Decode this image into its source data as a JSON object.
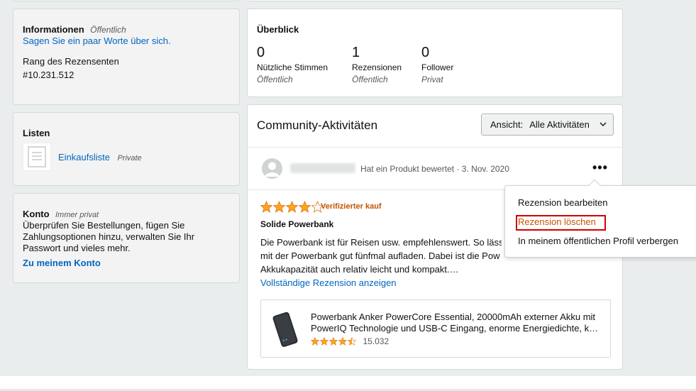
{
  "info_card": {
    "title": "Informationen",
    "visibility": "Öffentlich",
    "about_link": "Sagen Sie ein paar Worte über sich.",
    "rank_label": "Rang des Rezensenten",
    "rank_value": "#10.231.512"
  },
  "lists_card": {
    "title": "Listen",
    "item_name": "Einkaufsliste",
    "item_visibility": "Private"
  },
  "account_card": {
    "title": "Konto",
    "visibility": "Immer privat",
    "description": "Überprüfen Sie Bestellungen, fügen Sie Zahlungsoptionen hinzu, verwalten Sie Ihr Passwort und vieles mehr.",
    "link": "Zu meinem Konto"
  },
  "overview": {
    "title": "Überblick",
    "stats": [
      {
        "value": "0",
        "label": "Nützliche Stimmen",
        "visibility": "Öffentlich"
      },
      {
        "value": "1",
        "label": "Rezensionen",
        "visibility": "Öffentlich"
      },
      {
        "value": "0",
        "label": "Follower",
        "visibility": "Privat"
      }
    ]
  },
  "community": {
    "title": "Community-Aktivitäten",
    "view_label": "Ansicht:",
    "view_value": "Alle Aktivitäten",
    "activity_text": "Hat ein Produkt bewertet · 3. Nov. 2020",
    "menu_glyph": "•••"
  },
  "review": {
    "rating": 4,
    "max_rating": 5,
    "verified": "Verifizierter kauf",
    "title": "Solide Powerbank",
    "lines": [
      "Die Powerbank ist für Reisen usw. empfehlenswert. So lässt",
      "mit der Powerbank gut fünfmal aufladen. Dabei ist die Pow",
      "Akkukapazität auch relativ leicht und kompakt.…"
    ],
    "full_link": "Vollständige Rezension anzeigen"
  },
  "product": {
    "name_line1": "Powerbank Anker PowerCore Essential, 20000mAh externer Akku mit",
    "name_line2": "PowerIQ Technologie und USB-C Eingang, enorme Energiedichte, k…",
    "rating": 4.5,
    "rating_count": "15.032"
  },
  "context_menu": {
    "items": [
      "Rezension bearbeiten",
      "Rezension löschen",
      "In meinem öffentlichen Profil verbergen"
    ],
    "highlighted_index": 1
  },
  "colors": {
    "link": "#0066c0",
    "star": "#ffa41c",
    "verified": "#c45500",
    "highlight": "#d20000"
  }
}
